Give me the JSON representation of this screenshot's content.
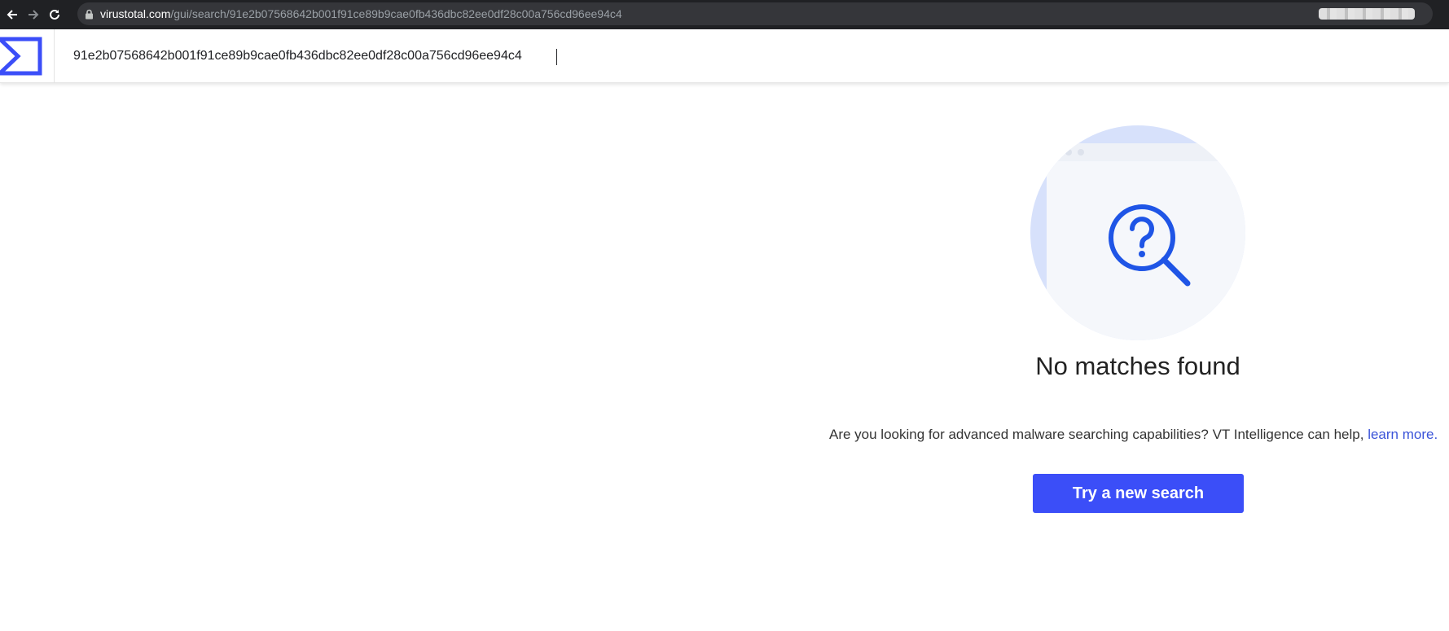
{
  "browser": {
    "url_domain": "virustotal.com",
    "url_path": "/gui/search/91e2b07568642b001f91ce89b9cae0fb436dbc82ee0df28c00a756cd96ee94c4"
  },
  "header": {
    "search_value": "91e2b07568642b001f91ce89b9cae0fb436dbc82ee0df28c00a756cd96ee94c4"
  },
  "empty_state": {
    "title": "No matches found",
    "help_text": "Are you looking for advanced malware searching capabilities? VT Intelligence can help, ",
    "help_link": "learn more.",
    "button_label": "Try a new search"
  },
  "colors": {
    "brand_blue": "#3b4ef8",
    "link_blue": "#3b54d9",
    "chrome_dark": "#202124"
  },
  "icons": [
    "back-arrow-icon",
    "forward-arrow-icon",
    "reload-icon",
    "lock-icon",
    "virustotal-logo-icon",
    "question-magnifier-icon"
  ]
}
